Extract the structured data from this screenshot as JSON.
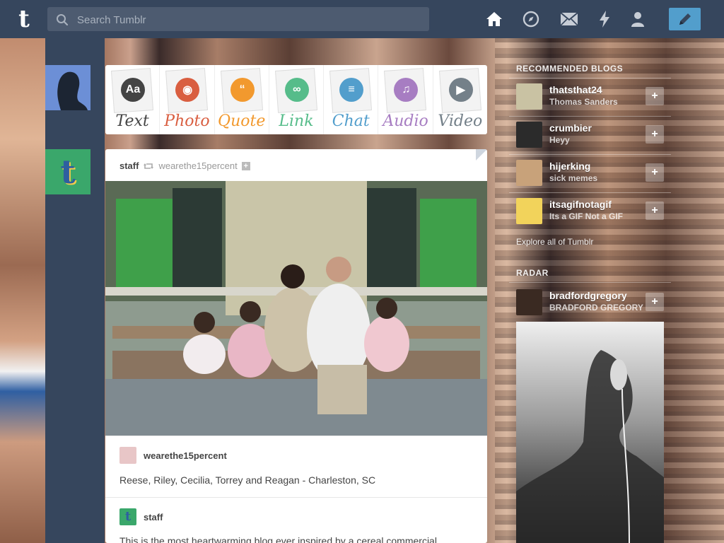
{
  "search": {
    "placeholder": "Search Tumblr"
  },
  "nav": {
    "home_icon": "home-icon",
    "explore_icon": "compass-icon",
    "inbox_icon": "envelope-icon",
    "activity_icon": "lightning-icon",
    "account_icon": "person-icon",
    "compose_icon": "pencil-icon"
  },
  "composer": {
    "types": [
      {
        "label": "Text",
        "color": "#444444",
        "icon": "Aa"
      },
      {
        "label": "Photo",
        "color": "#d95e40",
        "icon": "◉"
      },
      {
        "label": "Quote",
        "color": "#f2992e",
        "icon": "“"
      },
      {
        "label": "Link",
        "color": "#56bc8a",
        "icon": "∞"
      },
      {
        "label": "Chat",
        "color": "#529ecc",
        "icon": "≡"
      },
      {
        "label": "Audio",
        "color": "#a77dc2",
        "icon": "♫"
      },
      {
        "label": "Video",
        "color": "#748089",
        "icon": "▶"
      }
    ]
  },
  "post": {
    "author": "staff",
    "reblogged_from": "wearethe15percent",
    "source": {
      "name": "wearethe15percent",
      "caption": "Reese, Riley, Cecilia, Torrey and Reagan - Charleston, SC"
    },
    "reblog": {
      "name": "staff",
      "caption": "This is the most heartwarming blog ever inspired by a cereal commercial."
    }
  },
  "sidebar": {
    "recommended_title": "RECOMMENDED BLOGS",
    "recommended": [
      {
        "name": "thatsthat24",
        "subtitle": "Thomas Sanders",
        "color": "#c9c2a3"
      },
      {
        "name": "crumbier",
        "subtitle": "Heyy",
        "color": "#2b2b2b"
      },
      {
        "name": "hijerking",
        "subtitle": "sick memes",
        "color": "#c8a27a"
      },
      {
        "name": "itsagifnotagif",
        "subtitle": "Its a GIF Not a GIF",
        "color": "#f2d35b"
      }
    ],
    "explore_label": "Explore all of Tumblr",
    "radar_title": "RADAR",
    "radar": {
      "name": "bradfordgregory",
      "subtitle": "BRADFORD GREGORY",
      "color": "#3a2a22"
    }
  }
}
